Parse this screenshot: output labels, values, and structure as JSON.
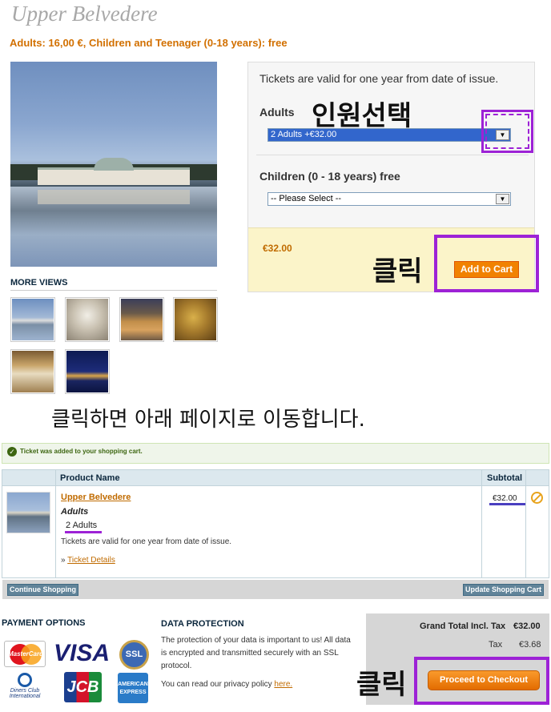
{
  "product": {
    "title": "Upper Belvedere",
    "price_line": "Adults: 16,00 €, Children and Teenager (0-18 years): free",
    "more_views_label": "MORE VIEWS",
    "validity": "Tickets are valid for one year from date of issue.",
    "adults_label": "Adults",
    "adults_selected": "2 Adults +€32.00",
    "children_label": "Children (0 - 18 years) free",
    "children_selected": "-- Please Select --",
    "total_price": "€32.00",
    "add_to_cart_label": "Add to Cart"
  },
  "annotations": {
    "select_people": "인원선택",
    "click_1": "클릭",
    "moves_to_page": "클릭하면 아래 페이지로 이동합니다.",
    "click_2": "클릭"
  },
  "cart": {
    "success_message": "Ticket was added to your shopping cart.",
    "col_product": "Product Name",
    "col_subtotal": "Subtotal",
    "item_name": "Upper Belvedere",
    "item_option_label": "Adults",
    "item_option_value": "2 Adults",
    "item_note": "Tickets are valid for one year from date of issue.",
    "details_prefix": "»",
    "details_link": "Ticket Details",
    "item_subtotal": "€32.00",
    "continue_label": "Continue Shopping",
    "update_label": "Update Shopping Cart"
  },
  "payment": {
    "title": "PAYMENT OPTIONS",
    "cards": [
      "MasterCard",
      "VISA",
      "SSL",
      "Diners Club International",
      "JCB",
      "AMERICAN EXPRESS"
    ]
  },
  "data_protection": {
    "title": "DATA PROTECTION",
    "text": "The protection of your data is important to us! All data is encrypted and transmitted securely with an SSL protocol.",
    "policy_prefix": "You can read our privacy policy",
    "policy_link": "here."
  },
  "totals": {
    "grand_total_label": "Grand Total Incl. Tax",
    "grand_total_value": "€32.00",
    "tax_label": "Tax",
    "tax_value": "€3.68",
    "checkout_label": "Proceed to Checkout"
  },
  "colors": {
    "accent_orange": "#f18200",
    "annotation_purple": "#9d22d6",
    "title_grey": "#a8a8a8"
  }
}
